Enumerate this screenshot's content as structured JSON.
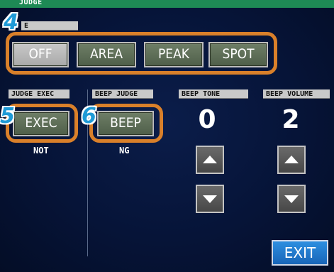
{
  "header": {
    "title": "JUDGE"
  },
  "mode": {
    "label": "E",
    "options": [
      {
        "label": "OFF",
        "selected": true
      },
      {
        "label": "AREA",
        "selected": false
      },
      {
        "label": "PEAK",
        "selected": false
      },
      {
        "label": "SPOT",
        "selected": false
      }
    ]
  },
  "judge_exec": {
    "label": "JUDGE EXEC",
    "button": "EXEC",
    "status": "NOT"
  },
  "beep_judge": {
    "label": "BEEP JUDGE",
    "button": "BEEP",
    "status": "NG"
  },
  "beep_tone": {
    "label": "BEEP TONE",
    "value": "0"
  },
  "beep_volume": {
    "label": "BEEP VOLUME",
    "value": "2"
  },
  "exit": {
    "label": "EXIT"
  },
  "callouts": {
    "mode": "4",
    "exec": "5",
    "beep": "6"
  },
  "colors": {
    "accent_frame": "#d9802a",
    "badge": "#1f9ad6",
    "exit": "#1f78cc",
    "topbar": "#1e8a55"
  }
}
